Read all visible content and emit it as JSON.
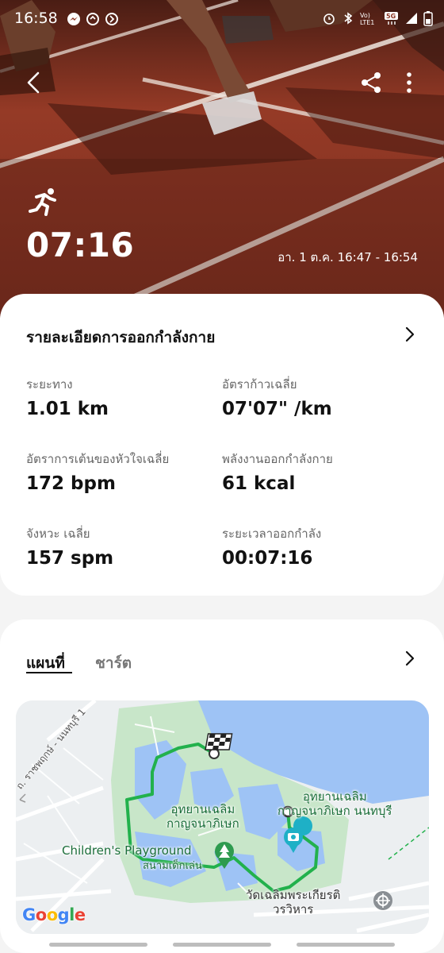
{
  "status_bar": {
    "time": "16:58",
    "left_icons": [
      "messenger-icon",
      "signal-app-icon",
      "clock-icon"
    ],
    "right_icons": [
      "alarm-icon",
      "bluetooth-icon",
      "volte-icon",
      "5g-icon",
      "signal-icon",
      "battery-icon"
    ],
    "volte_text": "Vo) LTE1",
    "network_text": "5G"
  },
  "header": {
    "activity_icon": "running-icon",
    "duration": "07:16",
    "date_range": "อา. 1 ต.ค. 16:47 - 16:54"
  },
  "details": {
    "title": "รายละเอียดการออกกำลังกาย",
    "metrics": [
      {
        "label": "ระยะทาง",
        "value": "1.01 km"
      },
      {
        "label": "อัตราก้าวเฉลี่ย",
        "value": "07'07\" /km"
      },
      {
        "label": "อัตราการเต้นของหัวใจเฉลี่ย",
        "value": "172 bpm"
      },
      {
        "label": "พลังงานออกกำลังกาย",
        "value": "61 kcal"
      },
      {
        "label": "จังหวะ เฉลี่ย",
        "value": "157 spm"
      },
      {
        "label": "ระยะเวลาออกกำลัง",
        "value": "00:07:16"
      }
    ]
  },
  "map_section": {
    "tabs": [
      {
        "label": "แผนที่",
        "active": true
      },
      {
        "label": "ชาร์ต",
        "active": false
      }
    ],
    "labels": {
      "park": "อุทยานเฉลิม\nกาญจนาภิเษก",
      "park_east": "อุทยานเฉลิม\nกาญจนาภิเษก นนทบุรี",
      "playground": "Children's Playground",
      "playground_th": "สนามเด็กเล่น",
      "temple": "วัดเฉลิมพระเกียรติ\nวรวิหาร",
      "road": "ถ. ราชพฤกษ์ - นนทบุรี 1",
      "google": "Google"
    },
    "colors": {
      "route": "#22b14c",
      "water": "#9ec3f5",
      "park": "#c8e6c9"
    }
  }
}
